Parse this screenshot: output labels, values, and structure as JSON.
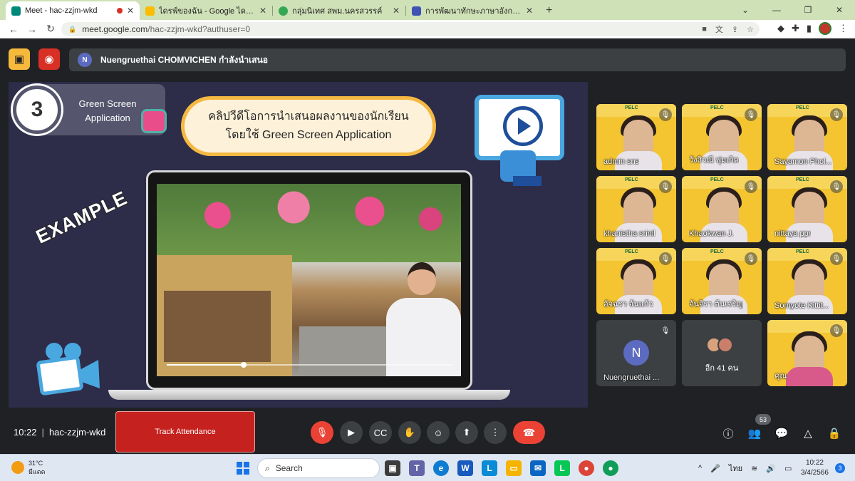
{
  "browser": {
    "tabs": [
      {
        "title": "Meet - hac-zzjm-wkd",
        "favicon_color": "#00897b"
      },
      {
        "title": "ไดรฟ์ของฉัน - Google ไดรฟ์",
        "favicon_color": "#fbbc04"
      },
      {
        "title": "กลุ่มนิเทศ สพม.นครสวรรค์",
        "favicon_color": "#34a853"
      },
      {
        "title": "การพัฒนาทักษะภาษาอังกฤษ English",
        "favicon_color": "#3f51b5"
      }
    ],
    "url_host": "meet.google.com",
    "url_path": "/hac-zzjm-wkd?authuser=0"
  },
  "meet": {
    "presenter_initial": "N",
    "presenting_text": "Nuengruethai CHOMVICHEN กำลังนำเสนอ",
    "slide": {
      "step_number": "3",
      "badge_line1": "Green Screen",
      "badge_line2": "Application",
      "title_line1": "คลิปวีดีโอการนำเสนอผลงานของนักเรียน",
      "title_line2": "โดยใช้ Green Screen Application",
      "example_label": "EXAMPLE",
      "video_progress": 0.27
    },
    "participants": [
      {
        "name": "admin sns",
        "muted": true
      },
      {
        "name": "วังสิวณี พุ่มเกิด",
        "muted": true
      },
      {
        "name": "Sayamon Phol...",
        "muted": true
      },
      {
        "name": "khanistha srinil",
        "muted": true
      },
      {
        "name": "Khaokwan J.",
        "muted": true
      },
      {
        "name": "nittaya ppr",
        "muted": true
      },
      {
        "name": "อัจฉรา จันแก้ว",
        "muted": true
      },
      {
        "name": "จันจิรา ต้นเจริญ",
        "muted": true
      },
      {
        "name": "Somyote Kittit...",
        "muted": true
      }
    ],
    "presenter_tile": {
      "initial": "N",
      "name": "Nuengruethai ..."
    },
    "more_tile": {
      "label": "อีก 41 คน"
    },
    "self_tile": {
      "name": "คุณ"
    },
    "time": "10:22",
    "meeting_code": "hac-zzjm-wkd",
    "track_attendance": "Track Attendance",
    "participant_count": "53"
  },
  "taskbar": {
    "temperature": "31°C",
    "weather": "มีแดด",
    "search_placeholder": "Search",
    "language": "ไทย",
    "clock_time": "10:22",
    "clock_date": "3/4/2566",
    "notifications": "3"
  }
}
